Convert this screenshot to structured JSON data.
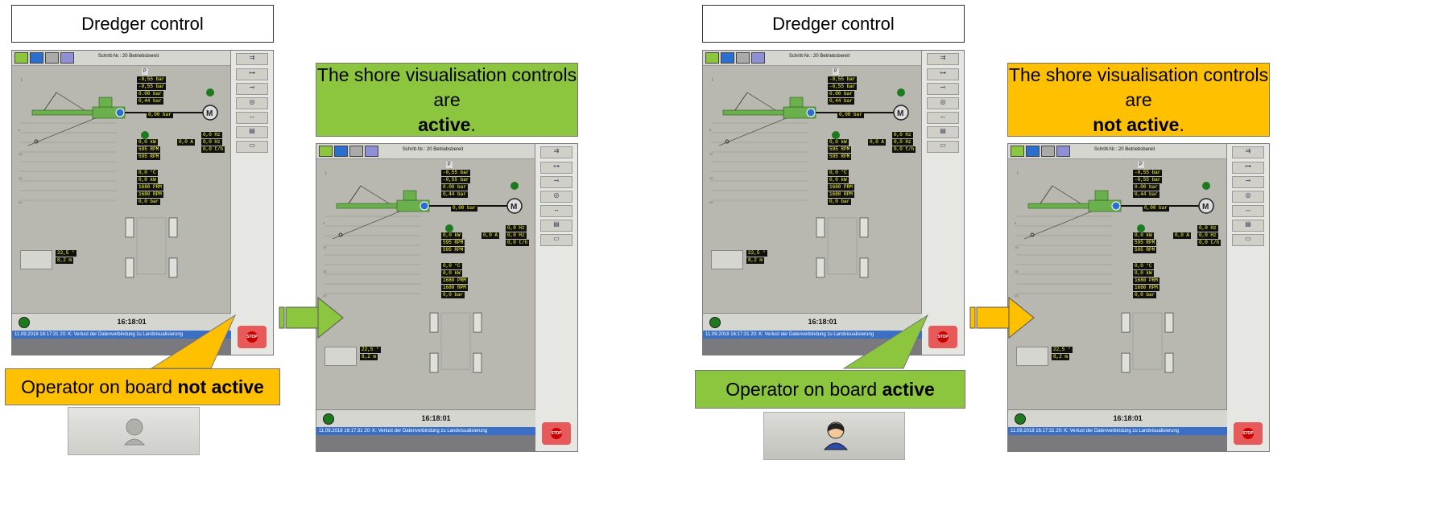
{
  "left": {
    "title": "Dredger control",
    "callout_top": {
      "text": "The shore visualisation controls are ",
      "bold": "active",
      "end": "."
    },
    "callout_bottom": {
      "text": "Operator on board ",
      "bold": "not active"
    },
    "screen": {
      "step_info": "Schritt-Nr.: 20   Betriebsbereit",
      "clock": "16:18:01",
      "message": "11.09.2018 16:17:31  20: K: Verlust der Datenverbindung zu Landvisualisierung"
    }
  },
  "right": {
    "title": "Dredger control",
    "callout_top": {
      "text": "The shore visualisation controls are ",
      "bold": "not active",
      "end": "."
    },
    "callout_bottom": {
      "text": "Operator on board ",
      "bold": "active"
    },
    "screen": {
      "step_info": "Schritt-Nr.: 20   Betriebsbereit",
      "clock": "16:18:01",
      "message": "11.09.2018 16:17:31  20: K: Verlust der Datenverbindung zu Landvisualisierung"
    }
  },
  "readouts": {
    "p_label": "P",
    "pressure": [
      "-0,55   bar",
      "-0,55   bar",
      "0.00    bar",
      "0,44    bar",
      "0,00    bar"
    ],
    "motor": [
      "0,0     kW",
      "595   RPM",
      "595   RPM"
    ],
    "electric": [
      "0,0       A"
    ],
    "flow": [
      "0,0    Hz",
      "0,0    Hz",
      "0,0     t/h"
    ],
    "engine": [
      "0,0     °C",
      "0,0     kW",
      "1680  PRM",
      "1680  RPM",
      "0,0    bar"
    ],
    "winch": [
      "22,5      °",
      "8,2      m"
    ]
  },
  "colors": {
    "green": "#8cc63f",
    "amber": "#ffc000",
    "screen_bg": "#b8b8b0",
    "hull": "#6ab04c",
    "message_bar": "#3a6fc6",
    "stop": "#e85a5a"
  }
}
